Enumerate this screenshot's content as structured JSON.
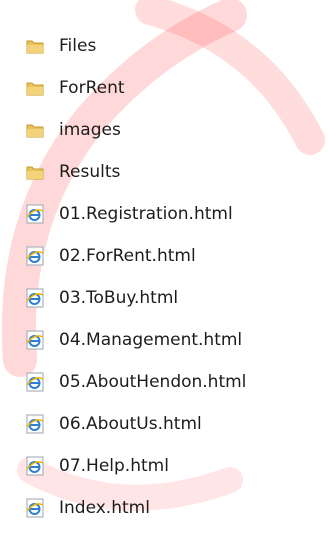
{
  "explorer": {
    "items": [
      {
        "label": "Files",
        "icon": "folder-icon",
        "type": "folder"
      },
      {
        "label": "ForRent",
        "icon": "folder-icon",
        "type": "folder"
      },
      {
        "label": "images",
        "icon": "folder-icon",
        "type": "folder"
      },
      {
        "label": "Results",
        "icon": "folder-icon",
        "type": "folder"
      },
      {
        "label": "01.Registration.html",
        "icon": "html-file-icon",
        "type": "file"
      },
      {
        "label": "02.ForRent.html",
        "icon": "html-file-icon",
        "type": "file"
      },
      {
        "label": "03.ToBuy.html",
        "icon": "html-file-icon",
        "type": "file"
      },
      {
        "label": "04.Management.html",
        "icon": "html-file-icon",
        "type": "file"
      },
      {
        "label": "05.AboutHendon.html",
        "icon": "html-file-icon",
        "type": "file"
      },
      {
        "label": "06.AboutUs.html",
        "icon": "html-file-icon",
        "type": "file"
      },
      {
        "label": "07.Help.html",
        "icon": "html-file-icon",
        "type": "file"
      },
      {
        "label": "Index.html",
        "icon": "html-file-icon",
        "type": "file"
      }
    ]
  },
  "colors": {
    "folder": "#e8c25a",
    "folder_dark": "#c99a2e",
    "ie_blue": "#2d7fd3",
    "watermark": "#ff2a2a"
  }
}
